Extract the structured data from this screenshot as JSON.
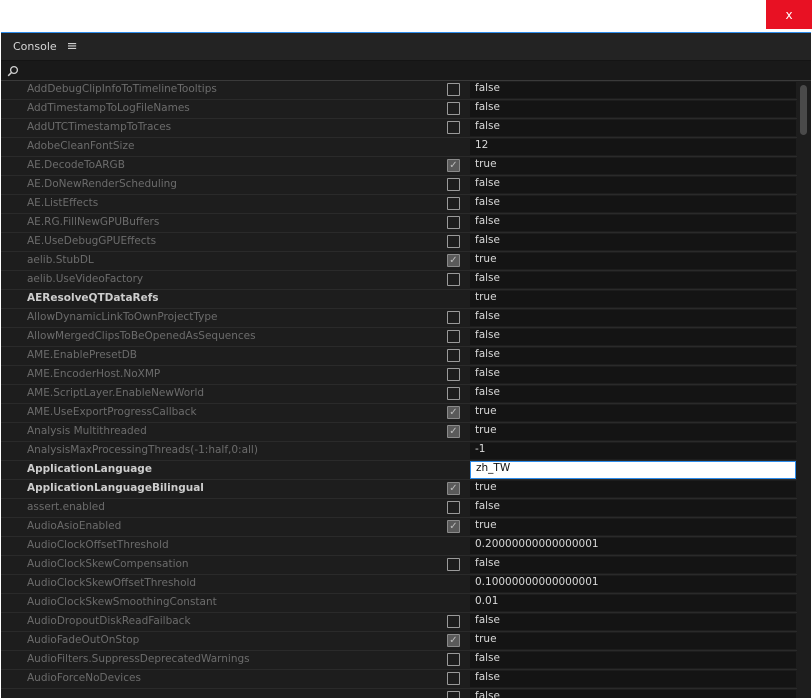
{
  "window": {
    "close_label": "x"
  },
  "panel": {
    "title": "Console",
    "menu_icon": "hamburger-icon"
  },
  "search": {
    "placeholder": "",
    "value": ""
  },
  "rows": [
    {
      "name": "AddDebugClipInfoToTimelineTooltips",
      "checkbox": true,
      "checked": false,
      "value": "false",
      "bold": false
    },
    {
      "name": "AddTimestampToLogFileNames",
      "checkbox": true,
      "checked": false,
      "value": "false",
      "bold": false
    },
    {
      "name": "AddUTCTimestampToTraces",
      "checkbox": true,
      "checked": false,
      "value": "false",
      "bold": false
    },
    {
      "name": "AdobeCleanFontSize",
      "checkbox": false,
      "checked": false,
      "value": "12",
      "bold": false
    },
    {
      "name": "AE.DecodeToARGB",
      "checkbox": true,
      "checked": true,
      "value": "true",
      "bold": false
    },
    {
      "name": "AE.DoNewRenderScheduling",
      "checkbox": true,
      "checked": false,
      "value": "false",
      "bold": false
    },
    {
      "name": "AE.ListEffects",
      "checkbox": true,
      "checked": false,
      "value": "false",
      "bold": false
    },
    {
      "name": "AE.RG.FillNewGPUBuffers",
      "checkbox": true,
      "checked": false,
      "value": "false",
      "bold": false
    },
    {
      "name": "AE.UseDebugGPUEffects",
      "checkbox": true,
      "checked": false,
      "value": "false",
      "bold": false
    },
    {
      "name": "aelib.StubDL",
      "checkbox": true,
      "checked": true,
      "value": "true",
      "bold": false
    },
    {
      "name": "aelib.UseVideoFactory",
      "checkbox": true,
      "checked": false,
      "value": "false",
      "bold": false
    },
    {
      "name": "AEResolveQTDataRefs",
      "checkbox": false,
      "checked": false,
      "value": "true",
      "bold": true
    },
    {
      "name": "AllowDynamicLinkToOwnProjectType",
      "checkbox": true,
      "checked": false,
      "value": "false",
      "bold": false
    },
    {
      "name": "AllowMergedClipsToBeOpenedAsSequences",
      "checkbox": true,
      "checked": false,
      "value": "false",
      "bold": false
    },
    {
      "name": "AME.EnablePresetDB",
      "checkbox": true,
      "checked": false,
      "value": "false",
      "bold": false
    },
    {
      "name": "AME.EncoderHost.NoXMP",
      "checkbox": true,
      "checked": false,
      "value": "false",
      "bold": false
    },
    {
      "name": "AME.ScriptLayer.EnableNewWorld",
      "checkbox": true,
      "checked": false,
      "value": "false",
      "bold": false
    },
    {
      "name": "AME.UseExportProgressCallback",
      "checkbox": true,
      "checked": true,
      "value": "true",
      "bold": false
    },
    {
      "name": "Analysis Multithreaded",
      "checkbox": true,
      "checked": true,
      "value": "true",
      "bold": false
    },
    {
      "name": "AnalysisMaxProcessingThreads(-1:half,0:all)",
      "checkbox": false,
      "checked": false,
      "value": "-1",
      "bold": false
    },
    {
      "name": "ApplicationLanguage",
      "checkbox": false,
      "checked": false,
      "value": "zh_TW",
      "bold": true,
      "active": true
    },
    {
      "name": "ApplicationLanguageBilingual",
      "checkbox": true,
      "checked": true,
      "value": "true",
      "bold": true
    },
    {
      "name": "assert.enabled",
      "checkbox": true,
      "checked": false,
      "value": "false",
      "bold": false
    },
    {
      "name": "AudioAsioEnabled",
      "checkbox": true,
      "checked": true,
      "value": "true",
      "bold": false
    },
    {
      "name": "AudioClockOffsetThreshold",
      "checkbox": false,
      "checked": false,
      "value": "0.20000000000000001",
      "bold": false
    },
    {
      "name": "AudioClockSkewCompensation",
      "checkbox": true,
      "checked": false,
      "value": "false",
      "bold": false
    },
    {
      "name": "AudioClockSkewOffsetThreshold",
      "checkbox": false,
      "checked": false,
      "value": "0.10000000000000001",
      "bold": false
    },
    {
      "name": "AudioClockSkewSmoothingConstant",
      "checkbox": false,
      "checked": false,
      "value": "0.01",
      "bold": false
    },
    {
      "name": "AudioDropoutDiskReadFailback",
      "checkbox": true,
      "checked": false,
      "value": "false",
      "bold": false
    },
    {
      "name": "AudioFadeOutOnStop",
      "checkbox": true,
      "checked": true,
      "value": "true",
      "bold": false
    },
    {
      "name": "AudioFilters.SuppressDeprecatedWarnings",
      "checkbox": true,
      "checked": false,
      "value": "false",
      "bold": false
    },
    {
      "name": "AudioForceNoDevices",
      "checkbox": true,
      "checked": false,
      "value": "false",
      "bold": false
    },
    {
      "name": "",
      "checkbox": true,
      "checked": false,
      "value": "false",
      "bold": false
    }
  ]
}
